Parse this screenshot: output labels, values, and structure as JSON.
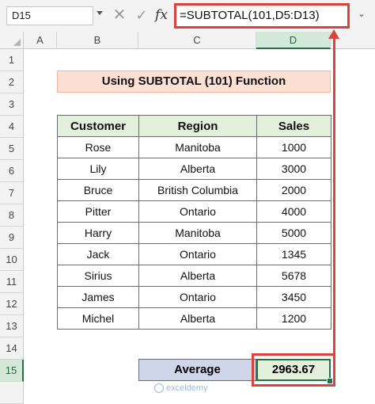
{
  "formula_bar": {
    "name_box": "D15",
    "fx_label": "fx",
    "formula": "=SUBTOTAL(101,D5:D13)"
  },
  "columns": [
    "A",
    "B",
    "C",
    "D"
  ],
  "rows": [
    "1",
    "2",
    "3",
    "4",
    "5",
    "6",
    "7",
    "8",
    "9",
    "10",
    "11",
    "12",
    "13",
    "14",
    "15"
  ],
  "title": "Using SUBTOTAL (101)  Function",
  "table": {
    "headers": [
      "Customer",
      "Region",
      "Sales"
    ],
    "rows": [
      [
        "Rose",
        "Manitoba",
        "1000"
      ],
      [
        "Lily",
        "Alberta",
        "3000"
      ],
      [
        "Bruce",
        "British Columbia",
        "2000"
      ],
      [
        "Pitter",
        "Ontario",
        "4000"
      ],
      [
        "Harry",
        "Manitoba",
        "5000"
      ],
      [
        "Jack",
        "Ontario",
        "1345"
      ],
      [
        "Sirius",
        "Alberta",
        "5678"
      ],
      [
        "James",
        "Ontario",
        "3450"
      ],
      [
        "Michel",
        "Alberta",
        "1200"
      ]
    ]
  },
  "average": {
    "label": "Average",
    "value": "2963.67"
  },
  "watermark": "exceldemy",
  "colors": {
    "highlight_red": "#d9443f",
    "header_green": "#e2efda",
    "title_peach": "#fce0d3",
    "average_blue": "#cfd6ea",
    "excel_green": "#217346"
  }
}
